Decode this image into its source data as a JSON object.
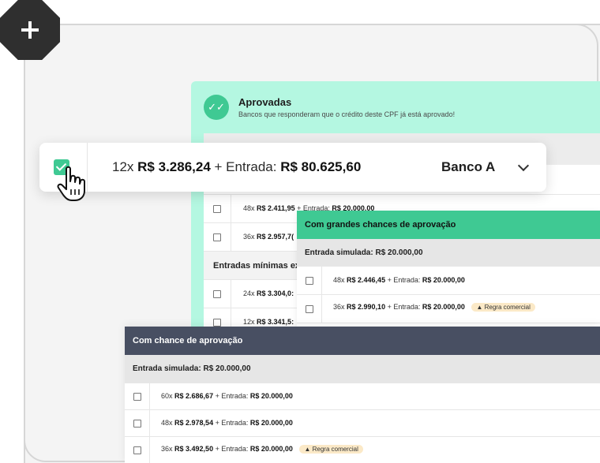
{
  "colors": {
    "approved_bg": "#b4f7e1",
    "green": "#3fc993",
    "chance_head": "#484f62",
    "tag_bg": "#fbe9c7"
  },
  "badge": {
    "icon": "plus-icon"
  },
  "approved": {
    "title": "Aprovadas",
    "subtitle": "Bancos que responderam que o crédito deste CPF já está aprovado!",
    "icon": "check-circle-icon",
    "rows": [
      {
        "n": "48x",
        "value": "R$ 2.411,95",
        "entrada_label": "+ Entrada:",
        "entrada": "R$ 20.000,00"
      },
      {
        "n": "36x",
        "value": "R$ 2.957,7("
      }
    ],
    "section_title": "Entradas mínimas ex",
    "rows2": [
      {
        "n": "24x",
        "value": "R$ 3.304,0:"
      },
      {
        "n": "12x",
        "value": "R$ 3.341,5:"
      }
    ]
  },
  "floating": {
    "n": "12x",
    "value": "R$ 3.286,24",
    "entrada_label": "+ Entrada:",
    "entrada": "R$ 80.625,60",
    "bank": "Banco A",
    "checkbox": "checked",
    "cursor_icon": "hand-pointer-icon"
  },
  "high": {
    "title": "Com grandes chances de aprovação",
    "sim": "Entrada simulada: R$ 20.000,00",
    "rows": [
      {
        "n": "48x",
        "value": "R$ 2.446,45",
        "entrada_label": "+ Entrada:",
        "entrada": "R$ 20.000,00",
        "tag": ""
      },
      {
        "n": "36x",
        "value": "R$ 2.990,10",
        "entrada_label": "+ Entrada:",
        "entrada": "R$ 20.000,00",
        "tag": "Regra comercial"
      }
    ]
  },
  "chance": {
    "title": "Com chance de aprovação",
    "sim": "Entrada simulada: R$ 20.000,00",
    "rows": [
      {
        "n": "60x",
        "value": "R$ 2.686,67",
        "entrada_label": "+ Entrada:",
        "entrada": "R$ 20.000,00",
        "tag": ""
      },
      {
        "n": "48x",
        "value": "R$ 2.978,54",
        "entrada_label": "+ Entrada:",
        "entrada": "R$ 20.000,00",
        "tag": ""
      },
      {
        "n": "36x",
        "value": "R$ 3.492,50",
        "entrada_label": "+ Entrada:",
        "entrada": "R$ 20.000,00",
        "tag": "Regra comercial"
      }
    ]
  }
}
